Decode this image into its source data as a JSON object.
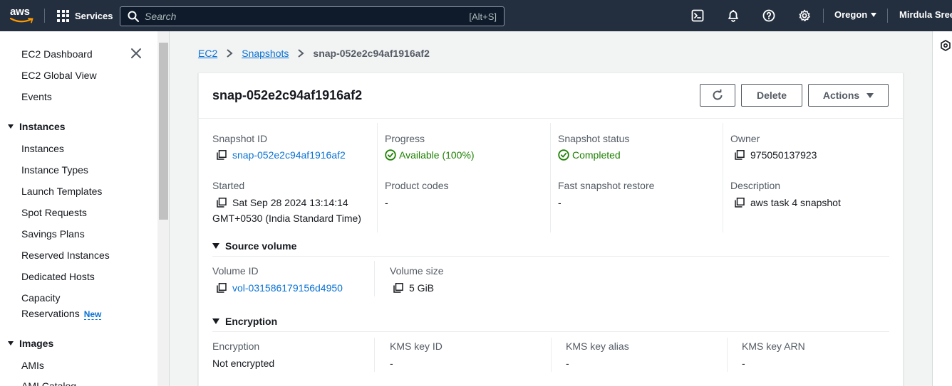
{
  "topnav": {
    "logo_text": "aws",
    "services_label": "Services",
    "search_placeholder": "Search",
    "search_shortcut": "[Alt+S]",
    "region": "Oregon",
    "user": "Mirdula Sree",
    "icons": [
      "cloudshell-icon",
      "notifications-icon",
      "help-icon",
      "settings-icon"
    ],
    "colors": {
      "bar": "#232f3e",
      "text": "#ffffff"
    }
  },
  "sidebar": {
    "top_links": [
      "EC2 Dashboard",
      "EC2 Global View",
      "Events"
    ],
    "instances": {
      "heading": "Instances",
      "items": [
        "Instances",
        "Instance Types",
        "Launch Templates",
        "Spot Requests",
        "Savings Plans",
        "Reserved Instances",
        "Dedicated Hosts",
        "Capacity",
        "Reservations"
      ],
      "new_badge": "New"
    },
    "images": {
      "heading": "Images",
      "items": [
        "AMIs",
        "AMI Catalog"
      ]
    }
  },
  "breadcrumb": {
    "items": [
      "EC2",
      "Snapshots"
    ],
    "current": "snap-052e2c94af1916af2"
  },
  "panel": {
    "title": "snap-052e2c94af1916af2",
    "buttons": {
      "delete": "Delete",
      "actions": "Actions"
    },
    "details": {
      "snapshot_id": {
        "label": "Snapshot ID",
        "value": "snap-052e2c94af1916af2"
      },
      "progress": {
        "label": "Progress",
        "value": "Available (100%)"
      },
      "status": {
        "label": "Snapshot status",
        "value": "Completed"
      },
      "owner": {
        "label": "Owner",
        "value": "975050137923"
      },
      "started": {
        "label": "Started",
        "value_line1": "Sat Sep 28 2024 13:14:14",
        "value_line2": "GMT+0530 (India Standard Time)"
      },
      "product_codes": {
        "label": "Product codes",
        "value": "-"
      },
      "fast_restore": {
        "label": "Fast snapshot restore",
        "value": "-"
      },
      "description": {
        "label": "Description",
        "value": "aws task 4 snapshot"
      }
    },
    "source_volume": {
      "heading": "Source volume",
      "volume_id": {
        "label": "Volume ID",
        "value": "vol-031586179156d4950"
      },
      "volume_size": {
        "label": "Volume size",
        "value": "5 GiB"
      }
    },
    "encryption": {
      "heading": "Encryption",
      "encryption": {
        "label": "Encryption",
        "value": "Not encrypted"
      },
      "kms_key_id": {
        "label": "KMS key ID",
        "value": "-"
      },
      "kms_key_alias": {
        "label": "KMS key alias",
        "value": "-"
      },
      "kms_key_arn": {
        "label": "KMS key ARN",
        "value": "-"
      }
    },
    "colors": {
      "link": "#0972d3",
      "success": "#1d8102",
      "label": "#545b64"
    }
  }
}
